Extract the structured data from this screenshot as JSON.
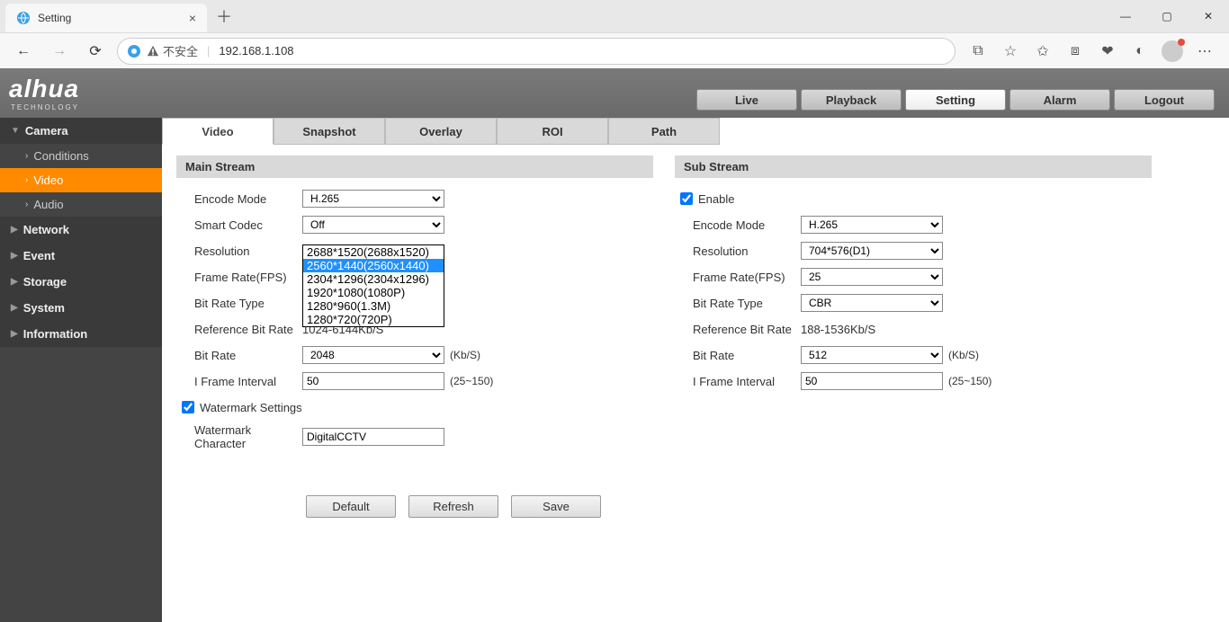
{
  "browser": {
    "tab_title": "Setting",
    "url": "192.168.1.108",
    "insecure_label": "不安全"
  },
  "brand": {
    "name": "alhua",
    "sub": "TECHNOLOGY"
  },
  "top_nav": [
    "Live",
    "Playback",
    "Setting",
    "Alarm",
    "Logout"
  ],
  "top_nav_active": 2,
  "sidebar": {
    "sections": [
      {
        "label": "Camera",
        "expanded": true,
        "items": [
          "Conditions",
          "Video",
          "Audio"
        ],
        "active_item": 1
      },
      {
        "label": "Network",
        "expanded": false
      },
      {
        "label": "Event",
        "expanded": false
      },
      {
        "label": "Storage",
        "expanded": false
      },
      {
        "label": "System",
        "expanded": false
      },
      {
        "label": "Information",
        "expanded": false
      }
    ]
  },
  "content_tabs": [
    "Video",
    "Snapshot",
    "Overlay",
    "ROI",
    "Path"
  ],
  "content_tab_active": 0,
  "main_stream": {
    "title": "Main Stream",
    "labels": {
      "encode_mode": "Encode Mode",
      "smart_codec": "Smart Codec",
      "resolution": "Resolution",
      "frame_rate": "Frame Rate(FPS)",
      "bit_rate_type": "Bit Rate Type",
      "ref_bit_rate": "Reference Bit Rate",
      "bit_rate": "Bit Rate",
      "i_frame": "I Frame Interval",
      "watermark_settings": "Watermark Settings",
      "watermark_char": "Watermark Character"
    },
    "values": {
      "encode_mode": "H.265",
      "smart_codec": "Off",
      "ref_bit_rate": "1024-6144Kb/S",
      "bit_rate": "2048",
      "bit_rate_unit": "(Kb/S)",
      "i_frame": "50",
      "i_frame_range": "(25~150)",
      "watermark_checked": true,
      "watermark_char": "DigitalCCTV"
    },
    "resolution_options": [
      "2688*1520(2688x1520)",
      "2560*1440(2560x1440)",
      "2304*1296(2304x1296)",
      "1920*1080(1080P)",
      "1280*960(1.3M)",
      "1280*720(720P)"
    ],
    "resolution_highlight_index": 1
  },
  "sub_stream": {
    "title": "Sub Stream",
    "enable_label": "Enable",
    "enable_checked": true,
    "labels": {
      "encode_mode": "Encode Mode",
      "resolution": "Resolution",
      "frame_rate": "Frame Rate(FPS)",
      "bit_rate_type": "Bit Rate Type",
      "ref_bit_rate": "Reference Bit Rate",
      "bit_rate": "Bit Rate",
      "i_frame": "I Frame Interval"
    },
    "values": {
      "encode_mode": "H.265",
      "resolution": "704*576(D1)",
      "frame_rate": "25",
      "bit_rate_type": "CBR",
      "ref_bit_rate": "188-1536Kb/S",
      "bit_rate": "512",
      "bit_rate_unit": "(Kb/S)",
      "i_frame": "50",
      "i_frame_range": "(25~150)"
    }
  },
  "buttons": {
    "default": "Default",
    "refresh": "Refresh",
    "save": "Save"
  }
}
